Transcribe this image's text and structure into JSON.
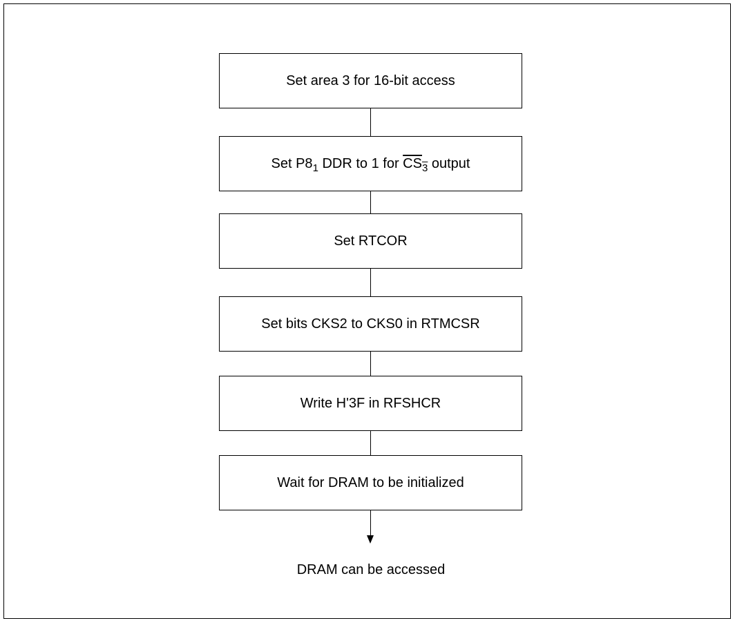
{
  "steps": [
    {
      "text": "Set area 3 for 16-bit access"
    },
    {
      "prefix": "Set P8",
      "sub1": "1",
      "middle": " DDR to 1 for ",
      "signal": "CS",
      "sub2": "3",
      "suffix": " output"
    },
    {
      "text": "Set RTCOR"
    },
    {
      "text": "Set bits CKS2 to CKS0 in RTMCSR"
    },
    {
      "text": "Write H'3F in RFSHCR"
    },
    {
      "text": "Wait for DRAM to be initialized"
    }
  ],
  "end_label": "DRAM can be accessed"
}
